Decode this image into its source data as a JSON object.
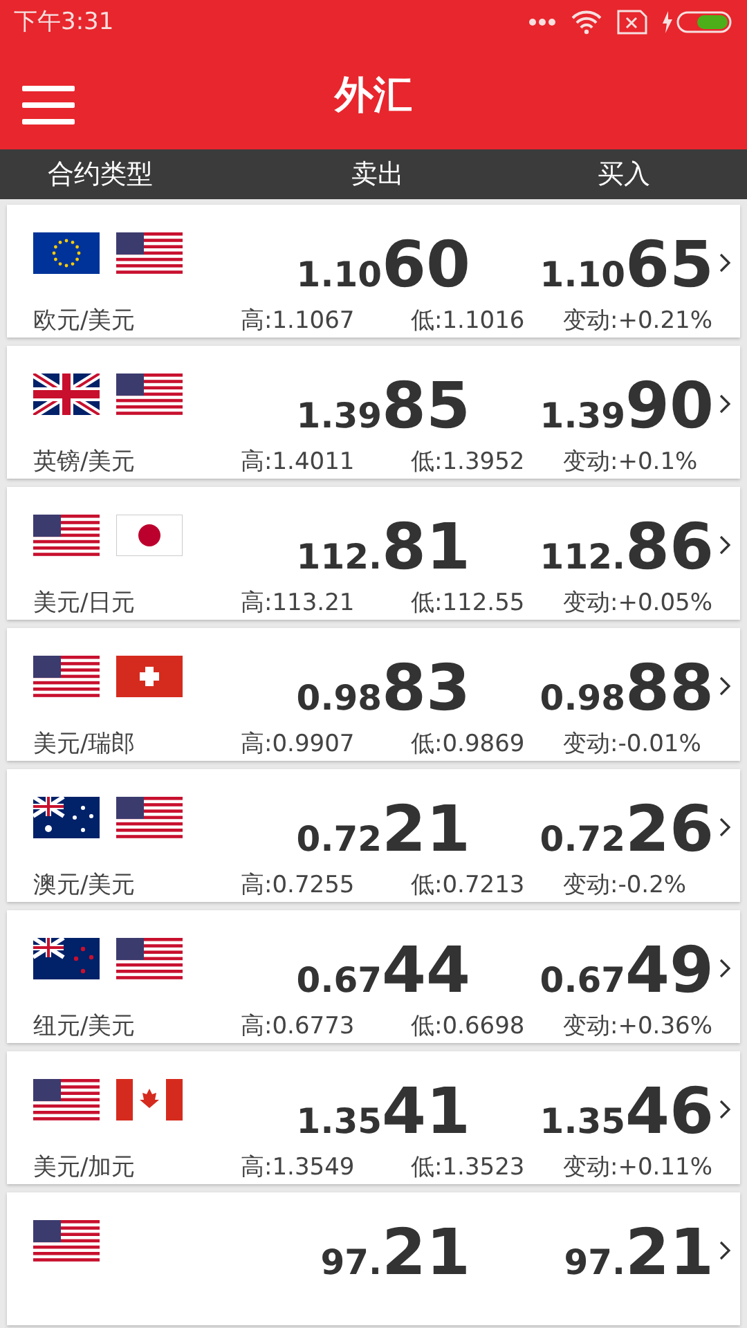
{
  "status_bar": {
    "time": "下午3:31"
  },
  "header": {
    "title": "外汇"
  },
  "columns": [
    "合约类型",
    "卖出",
    "买入"
  ],
  "rows": [
    {
      "flags": [
        {
          "kind": "eu"
        },
        {
          "kind": "us"
        }
      ],
      "pair": "欧元/美元",
      "bid_head": "1.10",
      "bid_tail": "60",
      "ask_head": "1.10",
      "ask_tail": "65",
      "high": "高:1.1067",
      "low": "低:1.1016",
      "change": "变动:+0.21%"
    },
    {
      "flags": [
        {
          "kind": "gb"
        },
        {
          "kind": "us"
        }
      ],
      "pair": "英镑/美元",
      "bid_head": "1.39",
      "bid_tail": "85",
      "ask_head": "1.39",
      "ask_tail": "90",
      "high": "高:1.4011",
      "low": "低:1.3952",
      "change": "变动:+0.1%"
    },
    {
      "flags": [
        {
          "kind": "us"
        },
        {
          "kind": "jp"
        }
      ],
      "pair": "美元/日元",
      "bid_head": "112.",
      "bid_tail": "81",
      "ask_head": "112.",
      "ask_tail": "86",
      "high": "高:113.21",
      "low": "低:112.55",
      "change": "变动:+0.05%"
    },
    {
      "flags": [
        {
          "kind": "us"
        },
        {
          "kind": "ch"
        }
      ],
      "pair": "美元/瑞郎",
      "bid_head": "0.98",
      "bid_tail": "83",
      "ask_head": "0.98",
      "ask_tail": "88",
      "high": "高:0.9907",
      "low": "低:0.9869",
      "change": "变动:-0.01%"
    },
    {
      "flags": [
        {
          "kind": "au"
        },
        {
          "kind": "us"
        }
      ],
      "pair": "澳元/美元",
      "bid_head": "0.72",
      "bid_tail": "21",
      "ask_head": "0.72",
      "ask_tail": "26",
      "high": "高:0.7255",
      "low": "低:0.7213",
      "change": "变动:-0.2%"
    },
    {
      "flags": [
        {
          "kind": "nz"
        },
        {
          "kind": "us"
        }
      ],
      "pair": "纽元/美元",
      "bid_head": "0.67",
      "bid_tail": "44",
      "ask_head": "0.67",
      "ask_tail": "49",
      "high": "高:0.6773",
      "low": "低:0.6698",
      "change": "变动:+0.36%"
    },
    {
      "flags": [
        {
          "kind": "us"
        },
        {
          "kind": "ca"
        }
      ],
      "pair": "美元/加元",
      "bid_head": "1.35",
      "bid_tail": "41",
      "ask_head": "1.35",
      "ask_tail": "46",
      "high": "高:1.3549",
      "low": "低:1.3523",
      "change": "变动:+0.11%"
    },
    {
      "flags": [
        {
          "kind": "us"
        }
      ],
      "bid_head": "97.",
      "bid_tail": "21",
      "ask_head": "97.",
      "ask_tail": "21"
    }
  ]
}
